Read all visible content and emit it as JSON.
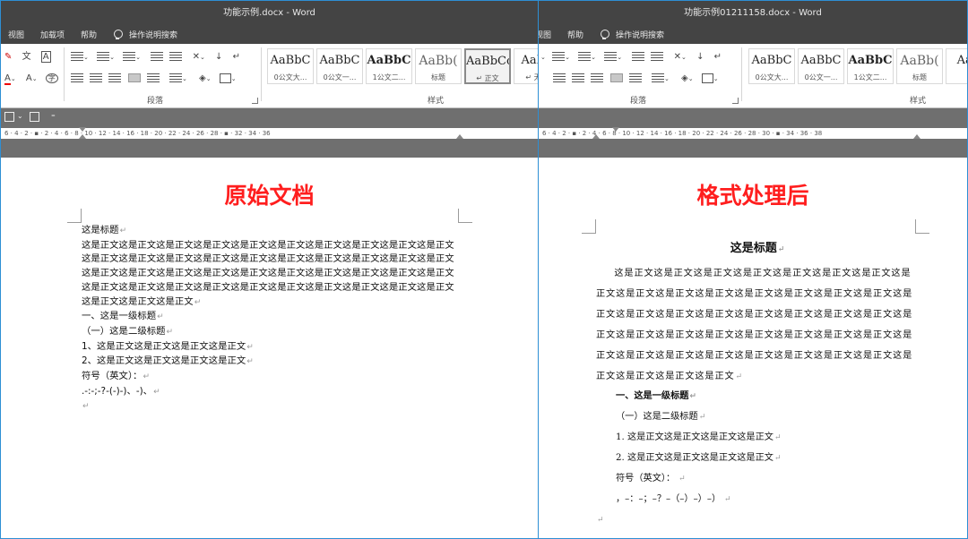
{
  "left_window": {
    "title": "功能示例.docx  -  Word",
    "menu": [
      "视图",
      "加载项",
      "帮助"
    ],
    "tell_me": "操作说明搜索",
    "group_labels": {
      "paragraph": "段落",
      "styles": "样式"
    },
    "styles": [
      {
        "sample": "AaBbC",
        "name": "0公文大...",
        "kind": "normal"
      },
      {
        "sample": "AaBbC",
        "name": "0公文一...",
        "kind": "normal"
      },
      {
        "sample": "AaBbC",
        "name": "1公文二...",
        "kind": "bold"
      },
      {
        "sample": "AaBb(",
        "name": "标题",
        "kind": "heading"
      },
      {
        "sample": "AaBbCcI",
        "name": "↵ 正文",
        "kind": "active"
      },
      {
        "sample": "AaBb",
        "name": "↵ 无间",
        "kind": "normal"
      }
    ],
    "ruler_numbers": "6 · 4 · 2 · ▪ · 2 · 4 · 6 · 8 · 10 · 12 · 14 · 16 · 18 · 20 · 22 · 24 · 26 · 28 · ▪ · 32 · 34 · 36",
    "banner": "原始文档",
    "document": [
      "这是标题",
      "这是正文这是正文这是正文这是正文这是正文这是正文这是正文这是正文这是正文这是正文这是正文这是正文这是正文这是正文这是正文这是正文这是正文这是正文这是正文这是正文这是正文这是正文这是正文这是正文这是正文这是正文这是正文这是正文这是正文这是正文这是正文这是正文这是正文这是正文这是正文这是正文这是正文这是正文这是正文这是正文这是正文这是正文这是正文",
      "一、这是一级标题",
      "（一）这是二级标题",
      "1、这是正文这是正文这是正文这是正文",
      "2、这是正文这是正文这是正文这是正文",
      "符号（英文）：",
      ".-:-;-?-(-)-)、-)、",
      ""
    ]
  },
  "right_window": {
    "title": "功能示例01211158.docx  -  Word",
    "menu": [
      "视图",
      "帮助"
    ],
    "tell_me": "操作说明搜索",
    "group_labels": {
      "paragraph": "段落",
      "styles": "样式"
    },
    "styles": [
      {
        "sample": "AaBbC",
        "name": "0公文大...",
        "kind": "normal"
      },
      {
        "sample": "AaBbC",
        "name": "0公文一...",
        "kind": "normal"
      },
      {
        "sample": "AaBbC",
        "name": "1公文二...",
        "kind": "bold"
      },
      {
        "sample": "AaBb(",
        "name": "标题",
        "kind": "heading"
      },
      {
        "sample": "AaB",
        "name": "",
        "kind": "normal"
      }
    ],
    "ruler_numbers": "6 · 4 · 2 · ▪ · 2 · 4 · 6 · 8 · 10 · 12 · 14 · 16 · 18 · 20 · 22 · 24 · 26 · 28 · 30 · ▪ · 34 · 36 · 38",
    "banner": "格式处理后",
    "document": {
      "title": "这是标题",
      "body": "这是正文这是正文这是正文这是正文这是正文这是正文这是正文这是正文这是正文这是正文这是正文这是正文这是正文这是正文这是正文这是正文这是正文这是正文这是正文这是正文这是正文这是正文这是正文这是正文这是正文这是正文这是正文这是正文这是正文这是正文这是正文这是正文这是正文这是正文这是正文这是正文这是正文这是正文这是正文这是正文这是正文这是正文这是正文",
      "h1": "一、这是一级标题",
      "h2": "（一）这是二级标题",
      "item1": "1. 这是正文这是正文这是正文这是正文",
      "item2": "2. 这是正文这是正文这是正文这是正文",
      "symbols_label": "符号（英文）：",
      "symbols": "，–：–；–？–（–）–）–）"
    }
  },
  "colors": {
    "banner": "#ff1e1e",
    "titlebar": "#444444",
    "frame": "#2e8fd4",
    "workspace": "#6f6f6f"
  }
}
